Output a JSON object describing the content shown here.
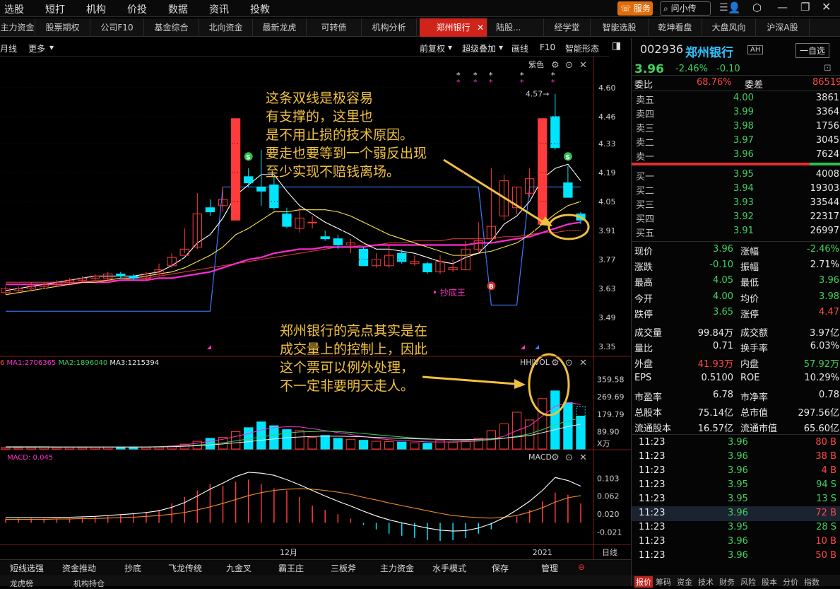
{
  "menu": {
    "items": [
      "选股",
      "短打",
      "机构",
      "价投",
      "数据",
      "资讯",
      "投教"
    ],
    "service": "服务",
    "search": "问小传"
  },
  "tabs": [
    "主力资金",
    "股票期权",
    "公司F10",
    "基金综合",
    "北向资金",
    "最新龙虎",
    "可转债",
    "机构分析",
    "郑州银行",
    "陆股...",
    "经学堂",
    "智能选股",
    "乾坤看盘",
    "大盘风向",
    "沪深A股"
  ],
  "toolbar": {
    "left": [
      "月线",
      "更多"
    ],
    "right": [
      "前复权",
      "超级叠加",
      "画线",
      "F10",
      "智能形态"
    ]
  },
  "colors": {
    "up": "#ff3b3b",
    "down": "#00e5ff",
    "ma5": "#ffffff",
    "ma10": "#f7e74a",
    "ma20": "#ff2bd0",
    "ma60": "#d63a3a",
    "annot": "#f0c040",
    "blueLine": "#3b7bff"
  },
  "chart_data": [
    {
      "type": "candlestick",
      "title": "紫色",
      "ylim": [
        3.35,
        4.62
      ],
      "yticks": [
        "4.60",
        "4.46",
        "4.33",
        "4.19",
        "4.05",
        "3.91",
        "3.77",
        "3.63",
        "3.49",
        "3.35"
      ],
      "xlabels": [
        "12月",
        "2021"
      ],
      "period": "日线",
      "candles": [
        [
          3.61,
          3.63,
          3.64,
          3.6
        ],
        [
          3.62,
          3.63,
          3.64,
          3.61
        ],
        [
          3.63,
          3.64,
          3.66,
          3.62
        ],
        [
          3.64,
          3.65,
          3.66,
          3.63
        ],
        [
          3.65,
          3.66,
          3.67,
          3.64
        ],
        [
          3.66,
          3.67,
          3.68,
          3.65
        ],
        [
          3.67,
          3.68,
          3.69,
          3.66
        ],
        [
          3.68,
          3.69,
          3.7,
          3.67
        ],
        [
          3.68,
          3.7,
          3.71,
          3.67
        ],
        [
          3.7,
          3.69,
          3.71,
          3.68
        ],
        [
          3.69,
          3.68,
          3.7,
          3.67
        ],
        [
          3.68,
          3.7,
          3.71,
          3.67
        ],
        [
          3.7,
          3.72,
          3.75,
          3.69
        ],
        [
          3.74,
          3.78,
          3.8,
          3.73
        ],
        [
          3.79,
          3.82,
          3.92,
          3.8
        ],
        [
          3.83,
          3.99,
          4.09,
          3.82
        ],
        [
          4.02,
          4.0,
          4.06,
          3.98
        ],
        [
          4.03,
          4.06,
          4.12,
          4.0
        ],
        [
          3.96,
          4.45,
          4.45,
          3.96
        ],
        [
          4.17,
          4.14,
          4.21,
          4.12
        ],
        [
          4.12,
          4.1,
          4.3,
          4.03
        ],
        [
          4.13,
          4.02,
          4.17,
          4.01
        ],
        [
          3.99,
          3.93,
          4.02,
          3.92
        ],
        [
          3.92,
          3.97,
          4.02,
          3.9
        ],
        [
          3.95,
          3.95,
          3.98,
          3.92
        ],
        [
          3.88,
          3.87,
          3.91,
          3.86
        ],
        [
          3.87,
          3.84,
          3.89,
          3.82
        ],
        [
          3.84,
          3.85,
          3.87,
          3.8
        ],
        [
          3.82,
          3.74,
          3.83,
          3.74
        ],
        [
          3.74,
          3.77,
          3.8,
          3.73
        ],
        [
          3.74,
          3.79,
          3.84,
          3.73
        ],
        [
          3.8,
          3.76,
          3.82,
          3.75
        ],
        [
          3.75,
          3.76,
          3.79,
          3.74
        ],
        [
          3.75,
          3.71,
          3.76,
          3.7
        ],
        [
          3.71,
          3.76,
          3.79,
          3.7
        ],
        [
          3.72,
          3.73,
          3.77,
          3.71
        ],
        [
          3.72,
          3.82,
          3.86,
          3.72
        ],
        [
          3.82,
          3.86,
          3.95,
          3.8
        ],
        [
          3.87,
          3.93,
          4.21,
          3.87
        ],
        [
          3.98,
          4.15,
          4.18,
          3.96
        ],
        [
          4.02,
          4.12,
          4.12,
          3.99
        ],
        [
          4.09,
          4.16,
          4.21,
          4.07
        ],
        [
          3.94,
          4.45,
          4.45,
          3.94
        ],
        [
          4.46,
          4.31,
          4.57,
          4.3
        ],
        [
          4.14,
          4.07,
          4.22,
          4.07
        ],
        [
          3.99,
          3.96,
          4.0,
          3.94
        ]
      ],
      "ma5": [
        3.62,
        3.63,
        3.64,
        3.65,
        3.66,
        3.67,
        3.68,
        3.69,
        3.69,
        3.69,
        3.69,
        3.7,
        3.71,
        3.74,
        3.78,
        3.85,
        3.89,
        3.97,
        4.08,
        4.13,
        4.18,
        4.18,
        4.1,
        4.03,
        3.99,
        3.95,
        3.92,
        3.89,
        3.85,
        3.82,
        3.82,
        3.81,
        3.8,
        3.78,
        3.76,
        3.75,
        3.78,
        3.8,
        3.86,
        3.94,
        3.98,
        4.05,
        4.16,
        4.21,
        4.23,
        4.15
      ],
      "ma10": [
        3.6,
        3.61,
        3.62,
        3.63,
        3.64,
        3.65,
        3.66,
        3.66,
        3.67,
        3.68,
        3.68,
        3.69,
        3.7,
        3.71,
        3.73,
        3.76,
        3.79,
        3.83,
        3.89,
        3.92,
        3.96,
        4.0,
        4.0,
        4.01,
        4.01,
        4.01,
        4.0,
        3.98,
        3.95,
        3.92,
        3.89,
        3.87,
        3.85,
        3.83,
        3.81,
        3.79,
        3.79,
        3.8,
        3.81,
        3.83,
        3.85,
        3.89,
        3.94,
        3.99,
        4.03,
        4.05
      ],
      "ma20": [
        3.65,
        3.65,
        3.65,
        3.65,
        3.65,
        3.65,
        3.66,
        3.66,
        3.66,
        3.67,
        3.67,
        3.67,
        3.68,
        3.68,
        3.69,
        3.7,
        3.71,
        3.73,
        3.75,
        3.77,
        3.78,
        3.8,
        3.81,
        3.82,
        3.82,
        3.83,
        3.83,
        3.83,
        3.83,
        3.84,
        3.84,
        3.84,
        3.84,
        3.84,
        3.84,
        3.84,
        3.84,
        3.85,
        3.85,
        3.86,
        3.87,
        3.88,
        3.9,
        3.92,
        3.94,
        3.95
      ],
      "ma60": [
        3.66,
        3.66,
        3.66,
        3.66,
        3.66,
        3.66,
        3.66,
        3.67,
        3.67,
        3.67,
        3.68,
        3.68,
        3.69,
        3.7,
        3.71,
        3.72,
        3.73,
        3.74,
        3.75,
        3.76,
        3.77,
        3.78,
        3.79,
        3.8,
        3.81,
        3.82,
        3.83,
        3.83,
        3.84,
        3.84,
        3.85,
        3.85,
        3.86,
        3.86,
        3.86,
        3.87,
        3.87,
        3.87,
        3.87,
        3.88,
        3.88,
        3.89,
        3.9,
        3.9,
        3.91,
        3.91
      ],
      "blue_line": [
        3.52,
        3.52,
        3.52,
        3.52,
        3.52,
        3.52,
        3.52,
        3.52,
        3.52,
        3.52,
        3.52,
        3.52,
        3.52,
        3.52,
        3.52,
        3.52,
        3.52,
        4.12,
        4.12,
        4.12,
        4.12,
        4.12,
        4.12,
        4.12,
        4.12,
        4.12,
        4.12,
        4.12,
        4.12,
        4.12,
        4.12,
        4.12,
        4.12,
        4.12,
        4.12,
        4.12,
        4.12,
        4.12,
        3.55,
        3.55,
        3.55,
        4.12,
        4.12,
        4.12,
        4.12,
        4.12
      ],
      "high_label": "4.57",
      "signals": [
        {
          "i": 19,
          "text": "S"
        },
        {
          "i": 44,
          "text": "S"
        },
        {
          "i": 38,
          "text": "B"
        }
      ],
      "tag": "抄底王"
    },
    {
      "type": "bar",
      "title": "HHJVOL",
      "legend": [
        "6",
        "MA1:2706365",
        "MA2:1896040",
        "MA3:1215394"
      ],
      "unit": "X万",
      "yticks": [
        "359.58",
        "269.69",
        "179.79",
        "89.90"
      ],
      "ylim": [
        0,
        420
      ],
      "values": [
        8,
        7,
        8,
        9,
        8,
        9,
        8,
        9,
        10,
        9,
        8,
        9,
        10,
        12,
        25,
        40,
        55,
        60,
        90,
        110,
        140,
        120,
        100,
        95,
        60,
        70,
        55,
        50,
        45,
        40,
        38,
        36,
        32,
        30,
        45,
        35,
        40,
        55,
        95,
        130,
        190,
        150,
        260,
        300,
        240,
        170
      ],
      "ma1": [
        10,
        10,
        10,
        10,
        10,
        10,
        10,
        10,
        10,
        10,
        10,
        10,
        12,
        16,
        22,
        30,
        40,
        50,
        65,
        80,
        98,
        110,
        115,
        114,
        105,
        95,
        85,
        75,
        64,
        55,
        48,
        44,
        40,
        37,
        36,
        37,
        38,
        41,
        50,
        66,
        95,
        120,
        170,
        220,
        240,
        230
      ],
      "ma2": [
        12,
        12,
        12,
        12,
        11,
        11,
        11,
        11,
        11,
        11,
        11,
        11,
        12,
        13,
        16,
        20,
        26,
        32,
        42,
        52,
        62,
        72,
        82,
        88,
        90,
        92,
        90,
        86,
        80,
        74,
        68,
        62,
        57,
        53,
        49,
        46,
        44,
        44,
        48,
        55,
        66,
        78,
        100,
        125,
        145,
        160
      ],
      "ma3": [
        10,
        10,
        10,
        10,
        10,
        10,
        10,
        10,
        10,
        10,
        10,
        10,
        11,
        12,
        14,
        17,
        21,
        26,
        32,
        38,
        45,
        52,
        58,
        62,
        65,
        66,
        66,
        65,
        63,
        60,
        57,
        55,
        53,
        51,
        50,
        49,
        49,
        50,
        52,
        56,
        62,
        70,
        84,
        100,
        116,
        128
      ]
    },
    {
      "type": "bar",
      "title": "MACD",
      "legend": "MACD: 0.045",
      "yticks": [
        "0.103",
        "0.062",
        "0.020",
        "-0.021"
      ],
      "ylim": [
        -0.05,
        0.13
      ],
      "values": [
        0.01,
        0.01,
        0.01,
        0.01,
        0.01,
        0.01,
        0.012,
        0.014,
        0.015,
        0.018,
        0.02,
        0.025,
        0.03,
        0.045,
        0.06,
        0.075,
        0.09,
        0.085,
        0.095,
        0.1,
        0.09,
        0.08,
        0.075,
        0.06,
        0.04,
        0.03,
        0.02,
        0.01,
        -0.005,
        -0.015,
        -0.025,
        -0.03,
        -0.035,
        -0.04,
        -0.042,
        -0.04,
        -0.035,
        -0.025,
        -0.015,
        0.0,
        0.015,
        0.03,
        0.05,
        0.07,
        0.065,
        0.045
      ],
      "dif": [
        0.012,
        0.012,
        0.012,
        0.012,
        0.013,
        0.013,
        0.014,
        0.015,
        0.017,
        0.019,
        0.021,
        0.024,
        0.028,
        0.036,
        0.047,
        0.062,
        0.078,
        0.092,
        0.107,
        0.117,
        0.115,
        0.11,
        0.1,
        0.088,
        0.075,
        0.062,
        0.05,
        0.039,
        0.027,
        0.016,
        0.007,
        0.0,
        -0.006,
        -0.012,
        -0.017,
        -0.019,
        -0.018,
        -0.012,
        -0.002,
        0.012,
        0.03,
        0.05,
        0.075,
        0.105,
        0.098,
        0.085
      ],
      "dea": [
        0.008,
        0.008,
        0.008,
        0.008,
        0.009,
        0.009,
        0.01,
        0.01,
        0.011,
        0.012,
        0.013,
        0.015,
        0.017,
        0.02,
        0.024,
        0.03,
        0.037,
        0.045,
        0.054,
        0.063,
        0.07,
        0.075,
        0.078,
        0.079,
        0.078,
        0.075,
        0.071,
        0.066,
        0.059,
        0.053,
        0.046,
        0.04,
        0.034,
        0.028,
        0.022,
        0.017,
        0.014,
        0.012,
        0.011,
        0.013,
        0.017,
        0.025,
        0.035,
        0.048,
        0.058,
        0.063
      ]
    }
  ],
  "annotations": {
    "note1": "这条双线是极容易\n有支撑的，这里也\n是不用止损的技术原因。\n要走也要等到一个弱反出现\n至少实现不赔钱离场。",
    "note2": "郑州银行的亮点其实是在\n成交量上的控制上，因此\n这个票可以例外处理，\n不一定非要明天走人。"
  },
  "quote": {
    "code": "002936",
    "name": "郑州银行",
    "market": "AH",
    "watch_button": "一自选",
    "price": "3.96",
    "change_pct": "-2.46%",
    "change": "-0.10",
    "weibi_label": "委比",
    "weibi": "68.76%",
    "weicha_label": "委差",
    "weicha": "86519",
    "asks": [
      {
        "label": "卖五",
        "price": "4.00",
        "vol": "3861"
      },
      {
        "label": "卖四",
        "price": "3.99",
        "vol": "3364"
      },
      {
        "label": "卖三",
        "price": "3.98",
        "vol": "1756"
      },
      {
        "label": "卖二",
        "price": "3.97",
        "vol": "3045"
      },
      {
        "label": "卖一",
        "price": "3.96",
        "vol": "7624"
      }
    ],
    "bids": [
      {
        "label": "买一",
        "price": "3.95",
        "vol": "4008"
      },
      {
        "label": "买二",
        "price": "3.94",
        "vol": "19303"
      },
      {
        "label": "买三",
        "price": "3.93",
        "vol": "33544"
      },
      {
        "label": "买四",
        "price": "3.92",
        "vol": "22317"
      },
      {
        "label": "买五",
        "price": "3.91",
        "vol": "26997"
      }
    ],
    "stats": [
      [
        "现价",
        "3.96",
        "涨幅",
        "-2.46%"
      ],
      [
        "涨跌",
        "-0.10",
        "振幅",
        "2.71%"
      ],
      [
        "最高",
        "4.05",
        "最低",
        "3.96"
      ],
      [
        "今开",
        "4.00",
        "均价",
        "3.98"
      ],
      [
        "跌停",
        "3.65",
        "涨停",
        "4.47"
      ],
      [
        "成交量",
        "99.84万",
        "成交额",
        "3.97亿"
      ],
      [
        "量比",
        "0.71",
        "换手率",
        "6.03%"
      ],
      [
        "外盘",
        "41.93万",
        "内盘",
        "57.92万"
      ],
      [
        "EPS",
        "0.5100",
        "ROE",
        "10.29%"
      ],
      [
        "市盈率",
        "6.78",
        "市净率",
        "0.78"
      ],
      [
        "总股本",
        "75.14亿",
        "总市值",
        "297.56亿"
      ],
      [
        "流通股本",
        "16.57亿",
        "流通市值",
        "65.60亿"
      ]
    ],
    "ticks": [
      [
        "11:23",
        "3.96",
        "80",
        "B"
      ],
      [
        "11:23",
        "3.96",
        "38",
        "B"
      ],
      [
        "11:23",
        "3.96",
        "4",
        "B"
      ],
      [
        "11:23",
        "3.95",
        "94",
        "S"
      ],
      [
        "11:23",
        "3.95",
        "13",
        "S"
      ],
      [
        "11:23",
        "3.96",
        "72",
        "B"
      ],
      [
        "11:23",
        "3.95",
        "28",
        "S"
      ],
      [
        "11:23",
        "3.96",
        "10",
        "B"
      ],
      [
        "11:23",
        "3.96",
        "50",
        "B"
      ]
    ],
    "bottom_tabs": [
      "报价",
      "筹码",
      "资金",
      "技术",
      "财务",
      "风险",
      "股本",
      "分价",
      "指数"
    ]
  },
  "bottom_nav": [
    "短线选强",
    "资金推动",
    "抄底",
    "飞龙传统",
    "九金叉",
    "霸王庄",
    "三板斧",
    "主力资金",
    "水手模式",
    "保存",
    "管理"
  ],
  "bottom2": [
    "龙虎榜",
    "机构持仓"
  ]
}
